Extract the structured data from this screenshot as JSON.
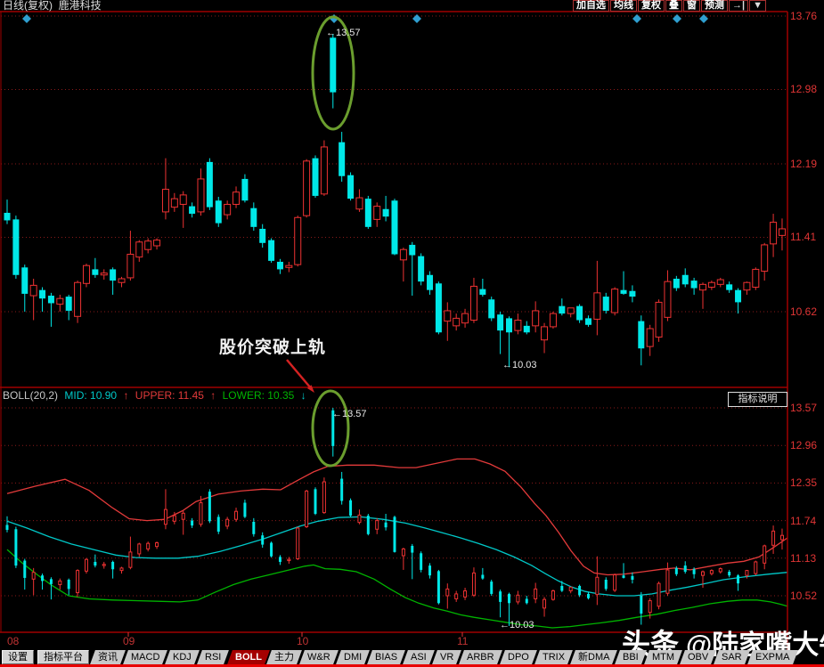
{
  "header": {
    "title": "日线(复权)  鹿港科技",
    "buttons": [
      "加自选",
      "均线",
      "复权",
      "叠",
      "窗",
      "预测"
    ],
    "icon_buttons": [
      "→|",
      "▼"
    ]
  },
  "indicator_bar": {
    "name": "BOLL(20,2)",
    "mid_label": "MID: 10.90",
    "mid_arrow": "↑",
    "upper_label": "UPPER: 11.45",
    "upper_arrow": "↑",
    "lower_label": "LOWER: 10.35",
    "lower_arrow": "↓",
    "help_button": "指标说明"
  },
  "annotations": {
    "breakout_text": "股价突破上轨",
    "peak_label_main": "←13.57",
    "peak_label_boll": "←13.57",
    "low_label_main": "←10.03",
    "low_label_boll": "←10.03"
  },
  "watermark": {
    "brand": "头条",
    "handle": "@陆家嘴大牛"
  },
  "tabbar": {
    "buttons": [
      "设置",
      "指标平台"
    ],
    "tabs": [
      "资讯",
      "MACD",
      "KDJ",
      "RSI",
      "BOLL",
      "主力",
      "W&R",
      "DMI",
      "BIAS",
      "ASI",
      "VR",
      "ARBR",
      "DPO",
      "TRIX",
      "新DMA",
      "BBI",
      "MTM",
      "OBV",
      "SAR",
      "EXPMA"
    ],
    "active_tab": "BOLL"
  },
  "colors": {
    "up": "#ee3232",
    "down": "#00e8e8",
    "band_upper": "#e23a3a",
    "band_mid": "#00c8c8",
    "band_lower": "#00b400",
    "grid": "#8a1a1a",
    "frame": "#a00000",
    "accent_red": "#e80000",
    "diamond": "#2f9fd0",
    "ellipse": "#6b9e2e",
    "arrow": "#d42222",
    "tick_label": "#e03535"
  },
  "chart_data": [
    {
      "type": "candlestick",
      "pane": "main",
      "title": "日线(复权) 鹿港科技",
      "y_ticks": [
        13.76,
        12.98,
        12.19,
        11.41,
        10.62
      ],
      "x_ticks": [
        {
          "label": "08",
          "x": 8
        },
        {
          "label": "09",
          "x": 138
        },
        {
          "label": "10",
          "x": 333
        },
        {
          "label": "11",
          "x": 513
        }
      ],
      "calibration": {
        "y_for_first_tick": 18,
        "y_for_last_tick": 350,
        "x0": 8,
        "dx": 9.886,
        "plot_top": 13,
        "plot_bottom": 435
      },
      "diamond_marker_xs": [
        30,
        375,
        468,
        715,
        760,
        790
      ],
      "peak_value": 13.57,
      "low_value": 10.03,
      "candles": [
        [
          11.67,
          11.81,
          11.55,
          11.59
        ],
        [
          11.6,
          11.64,
          10.97,
          11.01
        ],
        [
          11.09,
          11.12,
          10.62,
          10.81
        ],
        [
          10.79,
          10.97,
          10.53,
          10.9
        ],
        [
          10.85,
          10.88,
          10.62,
          10.76
        ],
        [
          10.79,
          10.82,
          10.46,
          10.71
        ],
        [
          10.7,
          10.8,
          10.62,
          10.76
        ],
        [
          10.78,
          10.8,
          10.53,
          10.63
        ],
        [
          10.57,
          10.95,
          10.5,
          10.93
        ],
        [
          10.92,
          11.13,
          10.88,
          11.11
        ],
        [
          11.07,
          11.19,
          10.98,
          11.01
        ],
        [
          11.01,
          11.07,
          10.96,
          11.03
        ],
        [
          11.07,
          11.09,
          10.8,
          10.95
        ],
        [
          10.93,
          10.99,
          10.88,
          10.97
        ],
        [
          10.98,
          11.48,
          10.95,
          11.23
        ],
        [
          11.2,
          11.38,
          11.15,
          11.36
        ],
        [
          11.28,
          11.4,
          11.24,
          11.37
        ],
        [
          11.32,
          11.4,
          11.28,
          11.38
        ],
        [
          11.68,
          12.25,
          11.6,
          11.92
        ],
        [
          11.73,
          11.88,
          11.68,
          11.82
        ],
        [
          11.76,
          11.9,
          11.51,
          11.86
        ],
        [
          11.74,
          11.78,
          11.62,
          11.66
        ],
        [
          11.68,
          12.14,
          11.64,
          12.03
        ],
        [
          12.21,
          12.25,
          11.7,
          11.73
        ],
        [
          11.8,
          11.84,
          11.52,
          11.56
        ],
        [
          11.65,
          11.8,
          11.6,
          11.76
        ],
        [
          11.76,
          11.95,
          11.72,
          11.89
        ],
        [
          12.03,
          12.08,
          11.78,
          11.8
        ],
        [
          11.72,
          11.78,
          11.48,
          11.52
        ],
        [
          11.5,
          11.55,
          11.3,
          11.35
        ],
        [
          11.38,
          11.4,
          11.14,
          11.16
        ],
        [
          11.15,
          11.18,
          11.02,
          11.07
        ],
        [
          11.09,
          11.15,
          11.04,
          11.11
        ],
        [
          11.12,
          11.64,
          11.1,
          11.62
        ],
        [
          11.64,
          12.24,
          11.62,
          12.22
        ],
        [
          12.25,
          12.28,
          11.83,
          11.85
        ],
        [
          11.87,
          12.44,
          11.85,
          12.37
        ],
        [
          13.53,
          13.57,
          12.78,
          12.95
        ],
        [
          12.42,
          12.53,
          12.0,
          12.06
        ],
        [
          12.07,
          12.1,
          11.8,
          11.82
        ],
        [
          11.71,
          11.92,
          11.68,
          11.83
        ],
        [
          11.82,
          11.85,
          11.5,
          11.52
        ],
        [
          11.6,
          11.78,
          11.52,
          11.74
        ],
        [
          11.71,
          11.85,
          11.58,
          11.63
        ],
        [
          11.8,
          11.82,
          11.22,
          11.23
        ],
        [
          11.17,
          11.3,
          10.94,
          11.28
        ],
        [
          11.33,
          11.36,
          10.79,
          11.22
        ],
        [
          11.21,
          11.24,
          10.9,
          10.94
        ],
        [
          11.01,
          11.05,
          10.8,
          10.85
        ],
        [
          10.92,
          10.94,
          10.38,
          10.4
        ],
        [
          10.52,
          10.72,
          10.31,
          10.63
        ],
        [
          10.47,
          10.6,
          10.42,
          10.55
        ],
        [
          10.5,
          10.65,
          10.45,
          10.6
        ],
        [
          10.53,
          10.98,
          10.5,
          10.89
        ],
        [
          10.86,
          10.97,
          10.78,
          10.8
        ],
        [
          10.75,
          10.78,
          10.52,
          10.55
        ],
        [
          10.59,
          10.62,
          10.17,
          10.42
        ],
        [
          10.55,
          10.57,
          10.03,
          10.4
        ],
        [
          10.42,
          10.6,
          10.38,
          10.53
        ],
        [
          10.47,
          10.52,
          10.38,
          10.4
        ],
        [
          10.47,
          10.73,
          10.4,
          10.63
        ],
        [
          10.32,
          10.5,
          10.18,
          10.46
        ],
        [
          10.46,
          10.62,
          10.44,
          10.6
        ],
        [
          10.68,
          10.76,
          10.58,
          10.6
        ],
        [
          10.6,
          10.66,
          10.56,
          10.66
        ],
        [
          10.68,
          10.7,
          10.5,
          10.53
        ],
        [
          10.55,
          10.58,
          10.46,
          10.48
        ],
        [
          10.54,
          11.16,
          10.37,
          10.82
        ],
        [
          10.78,
          10.82,
          10.6,
          10.63
        ],
        [
          10.61,
          10.88,
          10.58,
          10.86
        ],
        [
          10.85,
          11.05,
          10.8,
          10.81
        ],
        [
          10.84,
          10.9,
          10.72,
          10.78
        ],
        [
          10.52,
          10.58,
          10.05,
          10.23
        ],
        [
          10.25,
          10.48,
          10.15,
          10.44
        ],
        [
          10.35,
          10.75,
          10.3,
          10.72
        ],
        [
          10.56,
          11.06,
          10.52,
          10.94
        ],
        [
          10.97,
          11.0,
          10.84,
          10.87
        ],
        [
          11.01,
          11.08,
          10.88,
          10.91
        ],
        [
          10.95,
          10.98,
          10.8,
          10.87
        ],
        [
          10.85,
          10.93,
          10.65,
          10.91
        ],
        [
          10.88,
          10.95,
          10.85,
          10.93
        ],
        [
          10.91,
          10.98,
          10.88,
          10.96
        ],
        [
          10.91,
          10.94,
          10.82,
          10.85
        ],
        [
          10.85,
          10.87,
          10.6,
          10.72
        ],
        [
          10.85,
          10.94,
          10.8,
          10.93
        ],
        [
          10.88,
          11.09,
          10.85,
          11.07
        ],
        [
          11.05,
          11.35,
          10.95,
          11.33
        ],
        [
          11.34,
          11.66,
          11.2,
          11.57
        ],
        [
          11.43,
          11.61,
          11.27,
          11.5
        ]
      ]
    },
    {
      "type": "candlestick_bollinger",
      "pane": "boll",
      "indicator": "BOLL(20,2)",
      "y_ticks": [
        13.57,
        12.96,
        12.35,
        11.74,
        11.13,
        10.52
      ],
      "calibration": {
        "y_for_first_tick": 458,
        "y_for_last_tick": 669,
        "x0": 8,
        "dx": 9.886,
        "plot_top": 450,
        "plot_bottom": 710
      },
      "candles_same_as_main_pane": true,
      "bands": {
        "upper": [
          [
            8,
            12.18
          ],
          [
            40,
            12.3
          ],
          [
            73,
            12.41
          ],
          [
            100,
            12.23
          ],
          [
            125,
            11.96
          ],
          [
            145,
            11.77
          ],
          [
            165,
            11.74
          ],
          [
            185,
            11.76
          ],
          [
            205,
            11.9
          ],
          [
            220,
            12.05
          ],
          [
            245,
            12.17
          ],
          [
            270,
            12.22
          ],
          [
            295,
            12.25
          ],
          [
            315,
            12.24
          ],
          [
            335,
            12.4
          ],
          [
            352,
            12.53
          ],
          [
            368,
            12.62
          ],
          [
            390,
            12.64
          ],
          [
            420,
            12.64
          ],
          [
            448,
            12.6
          ],
          [
            467,
            12.6
          ],
          [
            490,
            12.67
          ],
          [
            513,
            12.74
          ],
          [
            533,
            12.74
          ],
          [
            550,
            12.66
          ],
          [
            567,
            12.54
          ],
          [
            585,
            12.28
          ],
          [
            600,
            12.02
          ],
          [
            613,
            11.82
          ],
          [
            627,
            11.55
          ],
          [
            641,
            11.25
          ],
          [
            655,
            11.0
          ],
          [
            667,
            10.89
          ],
          [
            682,
            10.86
          ],
          [
            700,
            10.87
          ],
          [
            722,
            10.91
          ],
          [
            742,
            10.95
          ],
          [
            757,
            10.97
          ],
          [
            775,
            10.94
          ],
          [
            797,
            11.0
          ],
          [
            817,
            11.05
          ],
          [
            835,
            11.08
          ],
          [
            852,
            11.15
          ],
          [
            867,
            11.29
          ],
          [
            884,
            11.46
          ]
        ],
        "mid": [
          [
            8,
            11.73
          ],
          [
            30,
            11.62
          ],
          [
            55,
            11.48
          ],
          [
            80,
            11.36
          ],
          [
            105,
            11.27
          ],
          [
            130,
            11.18
          ],
          [
            152,
            11.14
          ],
          [
            175,
            11.13
          ],
          [
            200,
            11.13
          ],
          [
            222,
            11.16
          ],
          [
            247,
            11.24
          ],
          [
            272,
            11.34
          ],
          [
            295,
            11.44
          ],
          [
            317,
            11.55
          ],
          [
            337,
            11.65
          ],
          [
            357,
            11.73
          ],
          [
            380,
            11.79
          ],
          [
            405,
            11.8
          ],
          [
            430,
            11.76
          ],
          [
            455,
            11.7
          ],
          [
            477,
            11.62
          ],
          [
            497,
            11.54
          ],
          [
            517,
            11.46
          ],
          [
            537,
            11.37
          ],
          [
            557,
            11.27
          ],
          [
            577,
            11.15
          ],
          [
            597,
            11.01
          ],
          [
            612,
            10.88
          ],
          [
            627,
            10.76
          ],
          [
            642,
            10.66
          ],
          [
            657,
            10.59
          ],
          [
            672,
            10.55
          ],
          [
            692,
            10.52
          ],
          [
            712,
            10.52
          ],
          [
            732,
            10.55
          ],
          [
            752,
            10.61
          ],
          [
            772,
            10.66
          ],
          [
            792,
            10.72
          ],
          [
            812,
            10.78
          ],
          [
            837,
            10.83
          ],
          [
            862,
            10.87
          ],
          [
            884,
            10.9
          ]
        ],
        "lower": [
          [
            8,
            11.27
          ],
          [
            25,
            11.05
          ],
          [
            42,
            10.86
          ],
          [
            58,
            10.69
          ],
          [
            77,
            10.52
          ],
          [
            100,
            10.47
          ],
          [
            127,
            10.45
          ],
          [
            152,
            10.44
          ],
          [
            177,
            10.43
          ],
          [
            202,
            10.42
          ],
          [
            222,
            10.45
          ],
          [
            242,
            10.58
          ],
          [
            262,
            10.7
          ],
          [
            282,
            10.79
          ],
          [
            302,
            10.86
          ],
          [
            322,
            10.93
          ],
          [
            342,
            11.0
          ],
          [
            352,
            11.02
          ],
          [
            365,
            10.96
          ],
          [
            382,
            10.95
          ],
          [
            400,
            10.91
          ],
          [
            420,
            10.79
          ],
          [
            438,
            10.63
          ],
          [
            455,
            10.49
          ],
          [
            470,
            10.4
          ],
          [
            487,
            10.32
          ],
          [
            502,
            10.27
          ],
          [
            517,
            10.21
          ],
          [
            532,
            10.17
          ],
          [
            550,
            10.13
          ],
          [
            567,
            10.09
          ],
          [
            585,
            10.05
          ],
          [
            602,
            10.03
          ],
          [
            620,
            10.0
          ],
          [
            640,
            10.02
          ],
          [
            657,
            10.05
          ],
          [
            675,
            10.08
          ],
          [
            695,
            10.12
          ],
          [
            715,
            10.17
          ],
          [
            737,
            10.22
          ],
          [
            757,
            10.28
          ],
          [
            777,
            10.33
          ],
          [
            797,
            10.39
          ],
          [
            817,
            10.43
          ],
          [
            833,
            10.45
          ],
          [
            850,
            10.45
          ],
          [
            865,
            10.42
          ],
          [
            877,
            10.38
          ],
          [
            884,
            10.35
          ]
        ]
      }
    }
  ]
}
